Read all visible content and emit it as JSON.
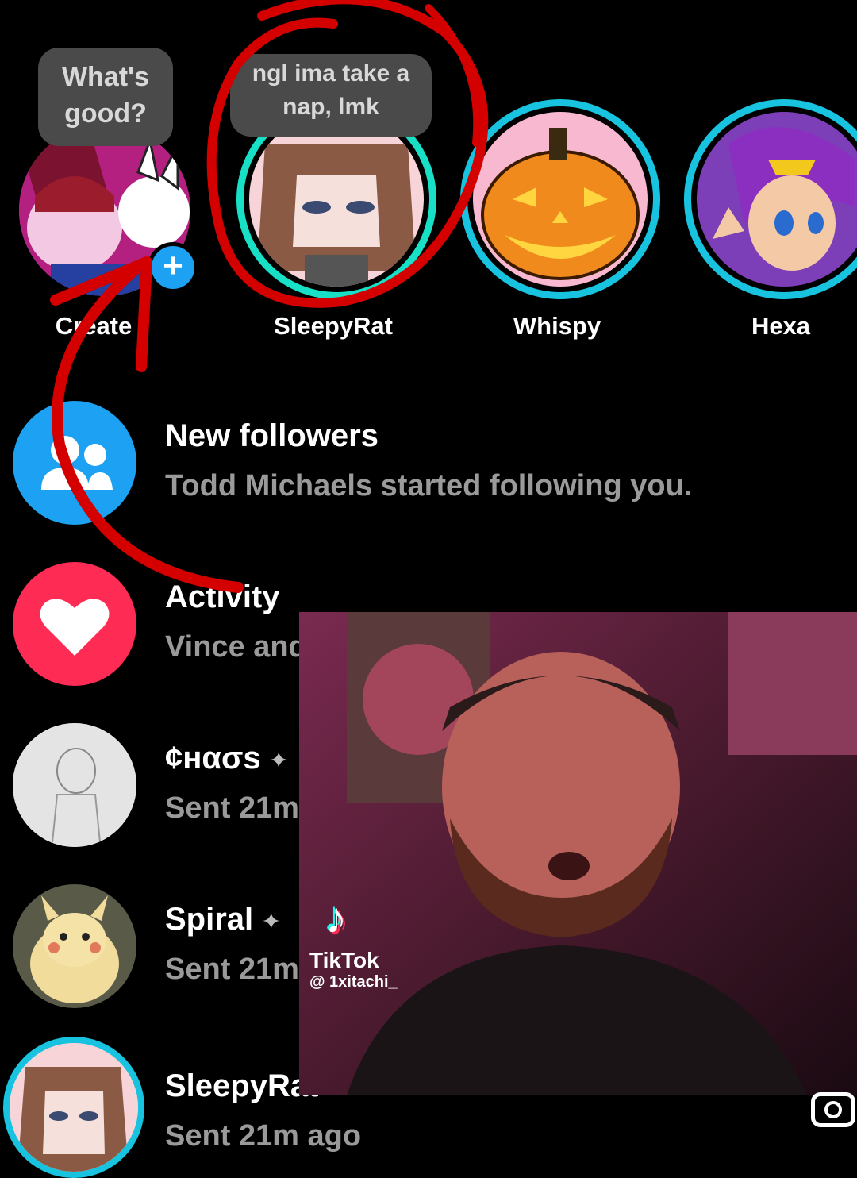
{
  "stories": [
    {
      "name": "Create",
      "bubble": "What's good?",
      "type": "create"
    },
    {
      "name": "SleepyRat",
      "bubble": "ngl ima take a nap, lmk"
    },
    {
      "name": "Whispy"
    },
    {
      "name": "Hexa"
    }
  ],
  "rows": {
    "followers": {
      "title": "New followers",
      "sub": "Todd Michaels started following you."
    },
    "activity": {
      "title": "Activity",
      "sub": "Vince and"
    },
    "chaos": {
      "title": "¢нασѕ",
      "sub": "Sent 21m"
    },
    "spiral": {
      "title": "Spiral",
      "sub": "Sent 21m"
    },
    "sleepyrat": {
      "title": "SleepyRat",
      "sub": "Sent 21m ago"
    }
  },
  "video": {
    "brand": "TikTok",
    "handle": "@ 1xitachi_"
  },
  "colors": {
    "ring": "#18c3e0",
    "followers": "#1da1f2",
    "activity": "#fe2c55",
    "annotation": "#d40000"
  },
  "icons": {
    "create": "plus-icon",
    "followers": "people-icon",
    "activity": "heart-icon",
    "pin": "pin-icon",
    "camera": "camera-icon"
  }
}
